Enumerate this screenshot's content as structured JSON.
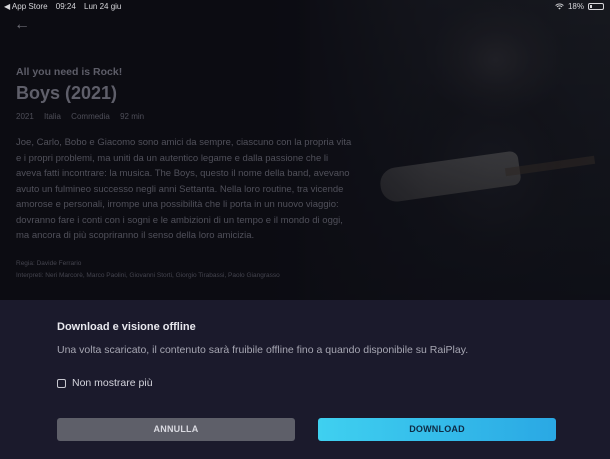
{
  "status_bar": {
    "carrier": "◀ App Store",
    "time": "09:24",
    "date": "Lun 24 giu",
    "battery": "18%",
    "battery_level": 0.18
  },
  "movie": {
    "tagline": "All you need is Rock!",
    "title": "Boys (2021)",
    "meta": {
      "year": "2021",
      "country": "Italia",
      "genre": "Commedia",
      "duration": "92 min"
    },
    "synopsis": "Joe, Carlo, Bobo e Giacomo sono amici da sempre, ciascuno con la propria vita e i propri problemi, ma uniti da un autentico legame e dalla passione che li aveva fatti incontrare: la musica. The Boys, questo il nome della band, avevano avuto un fulmineo successo negli anni Settanta. Nella loro routine, tra vicende amorose e personali, irrompe una possibilità che li porta in un nuovo viaggio: dovranno fare i conti con i sogni e le ambizioni di un tempo e il mondo di oggi, ma ancora di più scopriranno il senso della loro amicizia.",
    "director": "Regia: Davide Ferrario",
    "cast": "Interpreti: Neri Marcorè, Marco Paolini, Giovanni Storti, Giorgio Tirabassi, Paolo Giangrasso"
  },
  "dialog": {
    "title": "Download e visione offline",
    "message": "Una volta scaricato, il contenuto sarà fruibile offline fino a quando disponibile su RaiPlay.",
    "checkbox_label": "Non mostrare più",
    "checkbox_checked": false,
    "cancel_label": "ANNULLA",
    "download_label": "DOWNLOAD"
  },
  "icons": {
    "back": "back-arrow-icon",
    "wifi": "wifi-icon",
    "battery": "battery-icon"
  },
  "colors": {
    "download_button": "#2fbbeb",
    "cancel_button": "#5e5f69",
    "sheet_background": "#1b1a2c"
  }
}
